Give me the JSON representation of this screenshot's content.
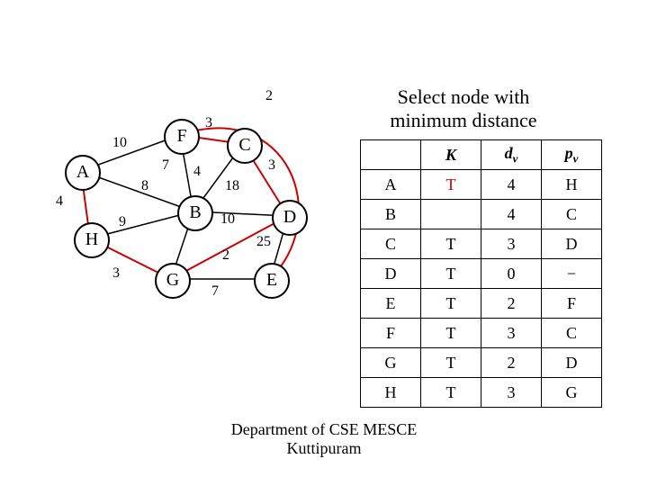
{
  "title_line1": "Select node with",
  "title_line2": "minimum distance",
  "nodes": {
    "A": "A",
    "B": "B",
    "C": "C",
    "D": "D",
    "E": "E",
    "F": "F",
    "G": "G",
    "H": "H"
  },
  "edge_weights": {
    "w2": "2",
    "w3a": "3",
    "w10a": "10",
    "w7a": "7",
    "w4a": "4",
    "w8": "8",
    "w3b": "3",
    "w18": "18",
    "w4b": "4",
    "w9": "9",
    "w10b": "10",
    "w25": "25",
    "w2b": "2",
    "w3c": "3",
    "w7b": "7"
  },
  "table": {
    "headers": {
      "k": "K",
      "d": "d",
      "p": "p",
      "v": "v"
    },
    "rows": [
      {
        "key": "A",
        "k": "T",
        "d": "4",
        "p": "H"
      },
      {
        "key": "B",
        "k": "",
        "d": "4",
        "p": "C"
      },
      {
        "key": "C",
        "k": "T",
        "d": "3",
        "p": "D"
      },
      {
        "key": "D",
        "k": "T",
        "d": "0",
        "p": "−"
      },
      {
        "key": "E",
        "k": "T",
        "d": "2",
        "p": "F"
      },
      {
        "key": "F",
        "k": "T",
        "d": "3",
        "p": "C"
      },
      {
        "key": "G",
        "k": "T",
        "d": "2",
        "p": "D"
      },
      {
        "key": "H",
        "k": "T",
        "d": "3",
        "p": "G"
      }
    ]
  },
  "footer_line1": "Department of CSE MESCE",
  "footer_line2": "Kuttipuram",
  "chart_data": {
    "type": "graph",
    "directed": false,
    "nodes": [
      "A",
      "B",
      "C",
      "D",
      "E",
      "F",
      "G",
      "H"
    ],
    "edges": [
      {
        "u": "A",
        "v": "F",
        "w": 10
      },
      {
        "u": "A",
        "v": "B",
        "w": 7
      },
      {
        "u": "A",
        "v": "H",
        "w": 4
      },
      {
        "u": "F",
        "v": "C",
        "w": 3
      },
      {
        "u": "F",
        "v": "E",
        "w": 2
      },
      {
        "u": "F",
        "v": "B",
        "w": 4
      },
      {
        "u": "B",
        "v": "C",
        "w": 18
      },
      {
        "u": "B",
        "v": "D",
        "w": 10
      },
      {
        "u": "B",
        "v": "H",
        "w": 9
      },
      {
        "u": "B",
        "v": "G",
        "w": 8
      },
      {
        "u": "C",
        "v": "D",
        "w": 3
      },
      {
        "u": "D",
        "v": "E",
        "w": 25
      },
      {
        "u": "D",
        "v": "G",
        "w": 2
      },
      {
        "u": "G",
        "v": "E",
        "w": 7
      },
      {
        "u": "G",
        "v": "H",
        "w": 3
      }
    ],
    "highlighted_edges": [
      [
        "F",
        "E"
      ],
      [
        "F",
        "C"
      ],
      [
        "C",
        "D"
      ],
      [
        "D",
        "G"
      ],
      [
        "G",
        "H"
      ],
      [
        "A",
        "H"
      ]
    ],
    "annotation": "Select node with minimum distance",
    "current_min_node": "A"
  }
}
